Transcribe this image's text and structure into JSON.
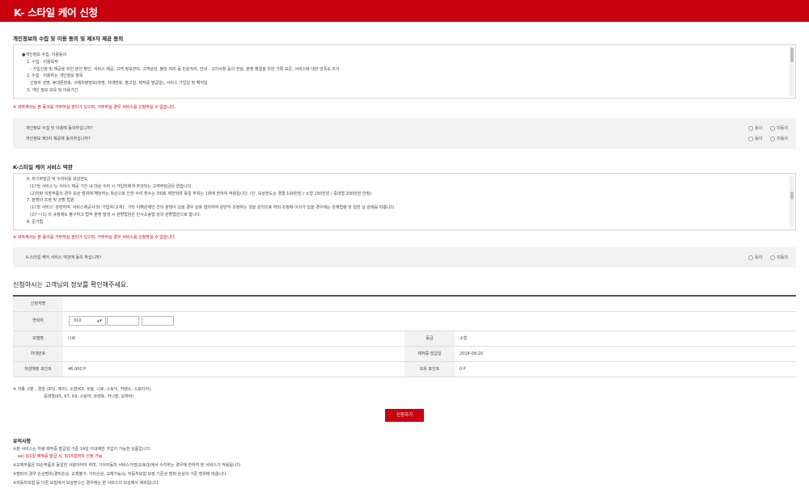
{
  "header": {
    "title": "K- 스타일 케어 신청"
  },
  "privacy": {
    "title": "개인정보의 수집 및 이용 동의 및 제3자 제공 동의",
    "lines": [
      {
        "text": "●개인정보 수집, 이용동의",
        "level": 0
      },
      {
        "text": "1. 수집 · 이용목적",
        "level": 1
      },
      {
        "text": "- 가입신청 및 재공을 위한 본인 확인, 서비스 제공, 고객 정보관리, 고객상담, 불만 처리 등 민원처리, 안내 · 고지사항 등의 전달, 분쟁 해결을 위한 기록 보존, 서비스에 대한 만족도 조사",
        "level": 2
      },
      {
        "text": "2. 수집 · 이용하는 개인정보 항목",
        "level": 1
      },
      {
        "text": "신청자 성명, 휴대폰번호, 구매차량정보(차명, 차대번호, 출고일, 제작증 발급일), 서비스 가입일 및 해지일",
        "level": 2
      },
      {
        "text": "3. 개인 정보 보유 및 이용기간",
        "level": 1
      }
    ],
    "warning": "※ 귀하께서는 본 동의를 거부하실 권리가 있으며, 거부하실 경우 서비스를 신청하실 수 없습니다.",
    "questions": [
      {
        "text": "개인정보 수집 및 이용에 동의하십니까?",
        "agree": "동의",
        "disagree": "미동의"
      },
      {
        "text": "개인정보 제3자 제공에 동의하십니까?",
        "agree": "동의",
        "disagree": "미동의"
      }
    ]
  },
  "service_terms": {
    "title": "K-스타일 케어 서비스 약관",
    "lines": [
      {
        "text": "6. 자기부담금 및 수리비용 보상한도",
        "level": 1
      },
      {
        "text": "(1)'당 서비스'는 서비스 제공 기간 내 대상 수리 시 가입자에게 부과되는 고객부담금은 없습니다.",
        "level": 2
      },
      {
        "text": "(2)차량 외장부품의 경우 보상 범위에 해당하는 파손으로 인한 수리 횟수는 3회로 제한되며 동일 부위는 1회에 한하여 적용됩니다. (단, 보상한도는 경형 100만원 / 소형 150만원 / 중대형 200만원 한정)",
        "level": 2
      },
      {
        "text": "7. 분쟁의 조정 및 관할 법원",
        "level": 1
      },
      {
        "text": "(1)'당 서비스' 관련하여 '서비스제공사'와 '가입자(고객)', 기타 이해관계인 간의 분쟁이 있을 경우 상호 협의하여 원만히 조정하는 것을 원칙으로 하되 조정에 이의가 있을 경우에는 관계법령 및 일반 상 관례를 따릅니다.",
        "level": 2
      },
      {
        "text": "(2)\"~(1) 의 규정에도 불구하고 법적 분쟁 발생 시 관할법원은 민사소송법 상의 관할법원으로 합니다.",
        "level": 2
      },
      {
        "text": "8. 준거법",
        "level": 1
      }
    ],
    "warning": "※ 귀하께서는 본 동의를 거부하실 권리가 있으며, 거부하실 경우 서비스를 신청하실 수 없습니다.",
    "question": {
      "text": "K-스타일 케어 서비스 약관에 동의 하십니까?",
      "agree": "동의",
      "disagree": "미동의"
    }
  },
  "customer_info": {
    "title": "신청하시는 고객님의 정보를 확인해주세요.",
    "labels": {
      "applicant": "신청자명",
      "contact": "연락처",
      "model": "모델명",
      "grade": "등급",
      "vin": "차대번호",
      "cert_date": "제작증 발급일",
      "expected_points": "차감예정 포인트",
      "held_points": "보유 포인트"
    },
    "values": {
      "applicant": "",
      "phone_prefix": "010",
      "model": "니로",
      "grade": "소형",
      "vin": "",
      "cert_date": "2018-08-20",
      "expected_points": "46,000 P",
      "held_points": "0 P"
    }
  },
  "vehicle_note": {
    "line1": "※ 차종 구분 : 경형 (모닝, 레이), 소형(K3, 쏘울, 니로, 스토닉, 카렌스, 스포티지),",
    "line2": "중대형(K5, K7, K9, 스팅어, 쏘렌토, 카니발, 모하비)"
  },
  "apply_button": "신청하기",
  "guide": {
    "title": "유의사항",
    "lines": [
      {
        "text": "※본 서비스는 차량 제작증 발급일 기준 14일 이내에만 가입이 가능한 상품입니다.",
        "red": false
      },
      {
        "text": "ex) 3/1일 제작증 발급 시, 3/15일까지 신청 가능",
        "red": true
      },
      {
        "text": "※교체부품은 파손부품과 동일한 사양이어야 하며, 기아자동차 서비스거점(오토Q)에서 수리하는 경우에 한하여 본 서비스가 적용됩니다.",
        "red": false
      },
      {
        "text": "※범퍼의 경우 손상범위(경미손상, 교체불가, 기타손상, 교체가능)는 자동차보험 보장 기준상 범퍼 손상의 기준 범위에 따릅니다.",
        "red": false
      },
      {
        "text": "※자동차보험 등 다른 보험에서 보상받으신 경우에는 본 서비스의 보상에서 제외됩니다.",
        "red": false
      }
    ]
  }
}
